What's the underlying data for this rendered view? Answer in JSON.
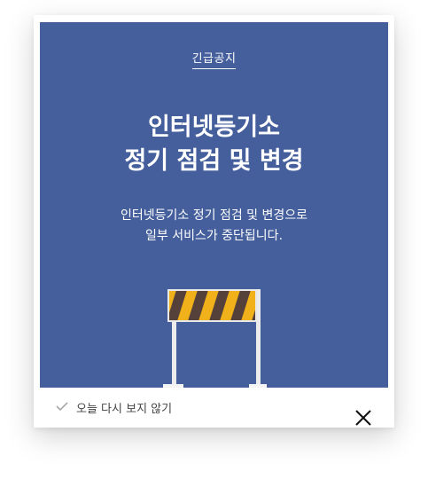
{
  "popup": {
    "tag": "긴급공지",
    "title_line1": "인터넷등기소",
    "title_line2": "정기 점검 및 변경",
    "desc_line1": "인터넷등기소 정기 점검 및 변경으로",
    "desc_line2": "일부 서비스가 중단됩니다.",
    "banner_color": "#445f9c",
    "illustration": "road-barrier-icon"
  },
  "footer": {
    "dont_show_today_label": "오늘 다시 보지 않기",
    "check_icon": "checkmark-icon",
    "close_icon": "close-icon"
  }
}
